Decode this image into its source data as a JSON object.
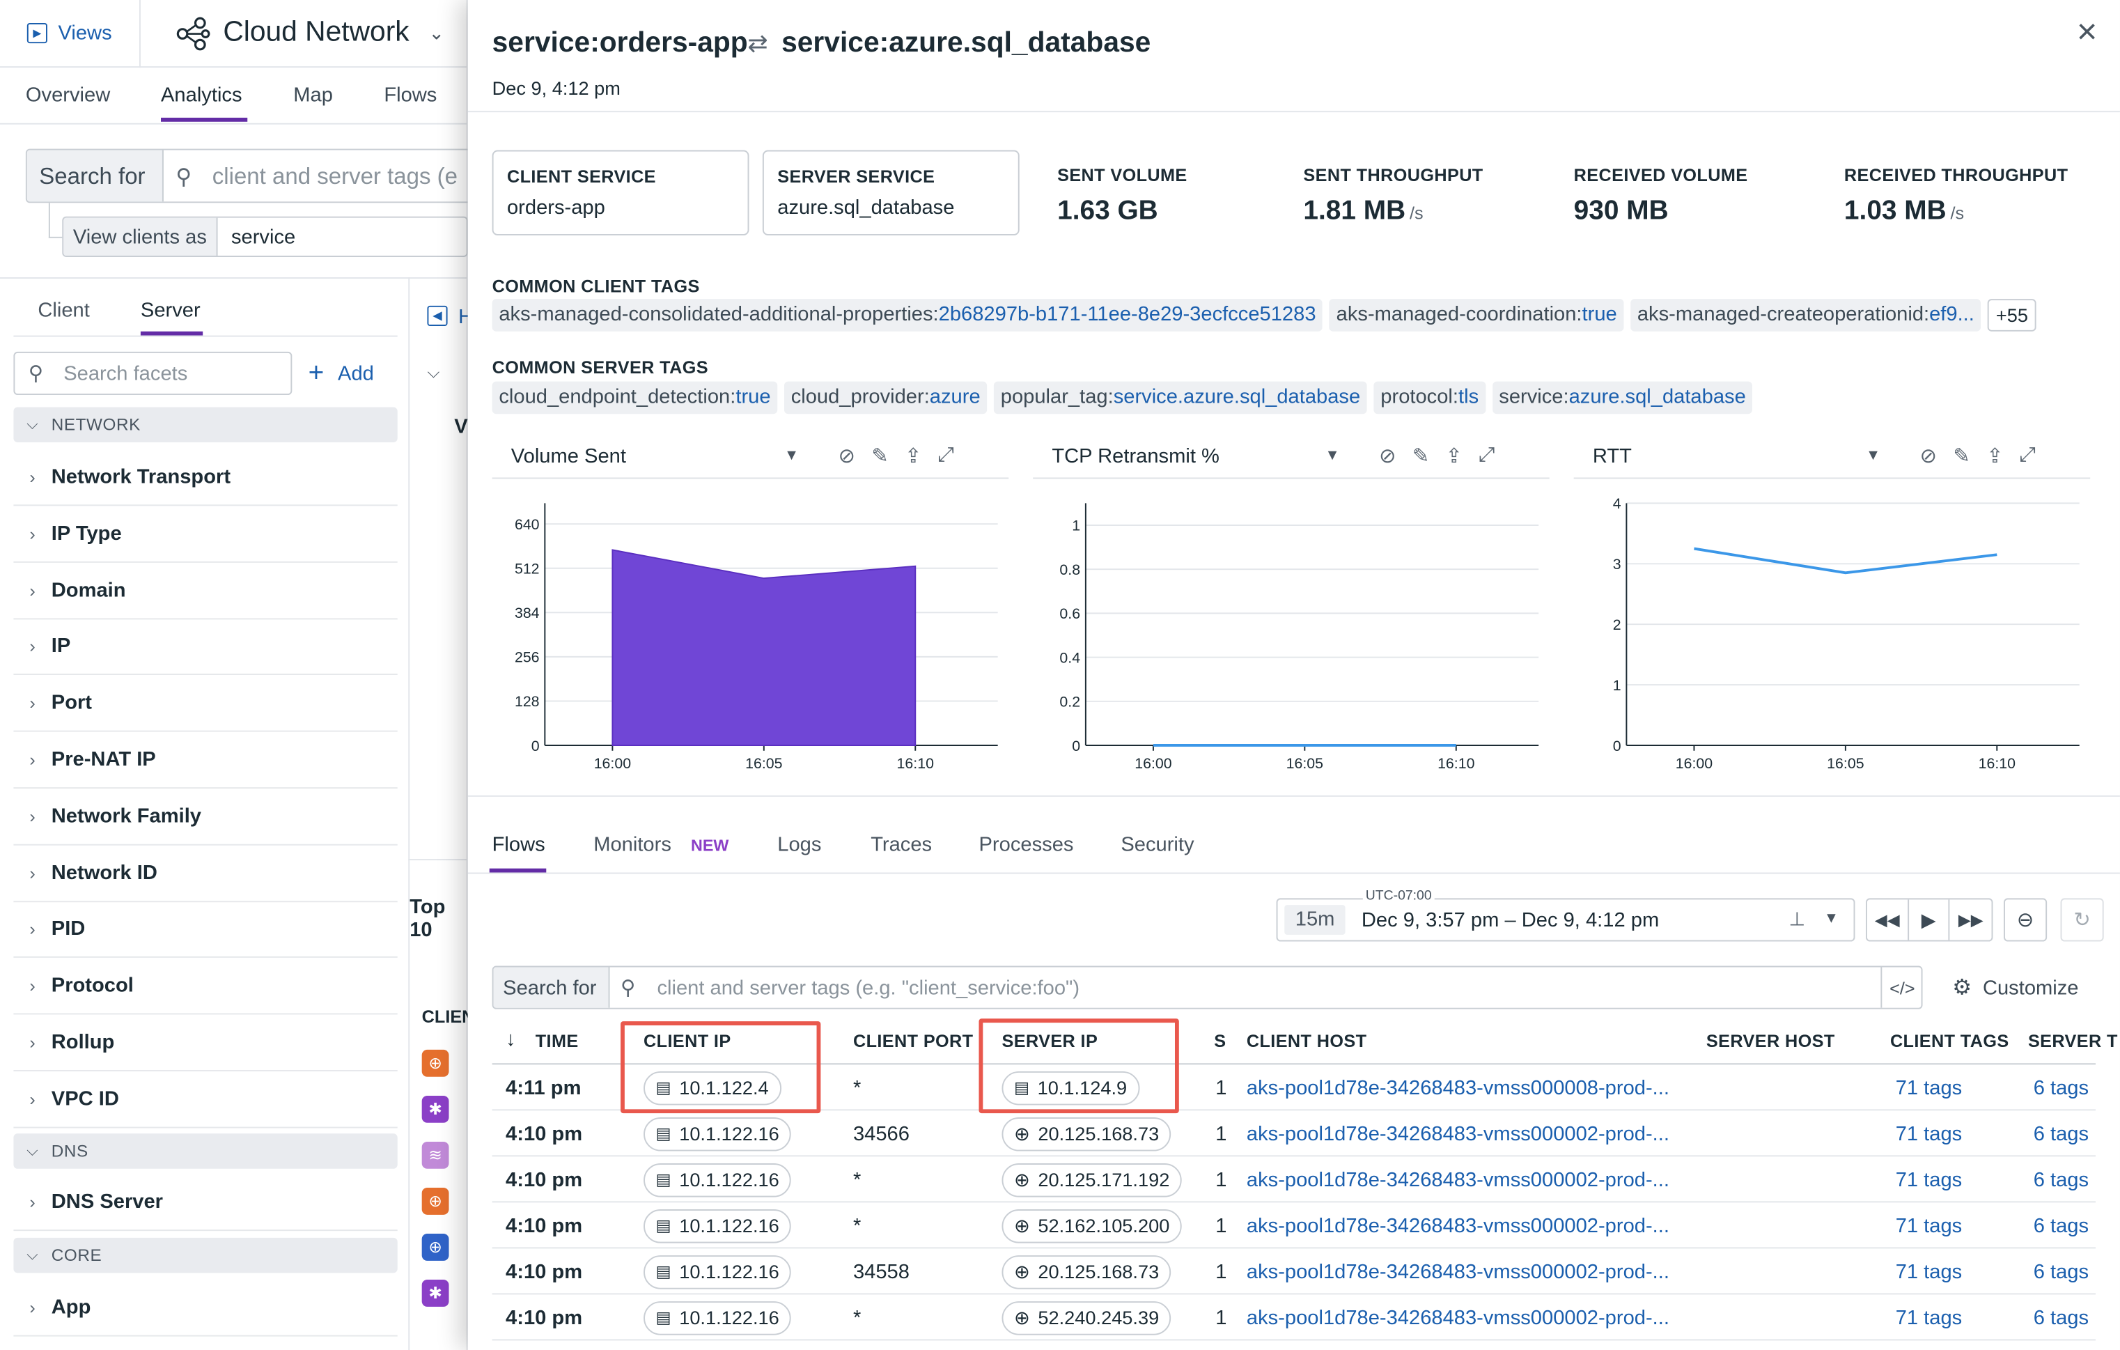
{
  "app": {
    "views_label": "Views",
    "title": "Cloud Network",
    "nav_tabs": [
      "Overview",
      "Analytics",
      "Map",
      "Flows"
    ],
    "search_for_label": "Search for",
    "search_placeholder": "client and server tags (e",
    "view_clients_as_label": "View clients as",
    "view_clients_as_value": "service",
    "facet_tabs": [
      "Client",
      "Server"
    ],
    "search_facets_placeholder": "Search facets",
    "add_label": "Add",
    "sections": {
      "network": "NETWORK",
      "dns": "DNS",
      "core": "CORE"
    },
    "network_facets": [
      "Network Transport",
      "IP Type",
      "Domain",
      "IP",
      "Port",
      "Pre-NAT IP",
      "Network Family",
      "Network ID",
      "PID",
      "Protocol",
      "Rollup",
      "VPC ID"
    ],
    "dns_facets": [
      "DNS Server"
    ],
    "core_facets": [
      "App"
    ],
    "partial_texts": {
      "top_label": "Top 10",
      "clien_label": "CLIEN",
      "v_label": "V",
      "h_label": "H"
    }
  },
  "panel": {
    "title_client": "service:orders-app",
    "title_server": "service:azure.sql_database",
    "date": "Dec 9, 4:12 pm",
    "client_service": {
      "label": "CLIENT SERVICE",
      "value": "orders-app"
    },
    "server_service": {
      "label": "SERVER SERVICE",
      "value": "azure.sql_database"
    },
    "stats": [
      {
        "label": "SENT VOLUME",
        "value": "1.63 GB",
        "unit": ""
      },
      {
        "label": "SENT THROUGHPUT",
        "value": "1.81 MB",
        "unit": "/s"
      },
      {
        "label": "RECEIVED VOLUME",
        "value": "930 MB",
        "unit": ""
      },
      {
        "label": "RECEIVED THROUGHPUT",
        "value": "1.03 MB",
        "unit": "/s"
      }
    ],
    "common_client_tags_label": "COMMON CLIENT TAGS",
    "common_client_tags": [
      {
        "k": "aks-managed-consolidated-additional-properties:",
        "v": "2b68297b-b171-11ee-8e29-3ecfcce51283"
      },
      {
        "k": "aks-managed-coordination:",
        "v": "true"
      },
      {
        "k": "aks-managed-createoperationid:",
        "v": "ef9..."
      }
    ],
    "client_tags_more": "+55",
    "common_server_tags_label": "COMMON SERVER TAGS",
    "common_server_tags": [
      {
        "k": "cloud_endpoint_detection:",
        "v": "true"
      },
      {
        "k": "cloud_provider:",
        "v": "azure"
      },
      {
        "k": "popular_tag:",
        "v": "service.azure.sql_database"
      },
      {
        "k": "protocol:",
        "v": "tls"
      },
      {
        "k": "service:",
        "v": "azure.sql_database"
      }
    ],
    "widgets": [
      "Volume Sent",
      "TCP Retransmit %",
      "RTT"
    ],
    "flow_tabs": [
      "Flows",
      "Monitors",
      "Logs",
      "Traces",
      "Processes",
      "Security"
    ],
    "new_badge": "NEW",
    "timezone": "UTC-07:00",
    "time_window": "15m",
    "time_range": "Dec 9, 3:57 pm – Dec 9, 4:12 pm",
    "flows_search_label": "Search for",
    "flows_search_placeholder": "client and server tags (e.g. \"client_service:foo\")",
    "customize_label": "Customize",
    "table_headers": [
      "TIME",
      "CLIENT IP",
      "CLIENT PORT",
      "SERVER IP",
      "S",
      "CLIENT HOST",
      "SERVER HOST",
      "CLIENT TAGS",
      "SERVER T"
    ],
    "rows": [
      {
        "time": "4:11 pm",
        "client_ip": "10.1.122.4",
        "client_port": "*",
        "server_ip": "10.1.124.9",
        "server_ip_type": "host",
        "s": "1",
        "client_host": "aks-pool1d78e-34268483-vmss000008-prod-...",
        "client_tags": "71 tags",
        "server_tags": "6 tags"
      },
      {
        "time": "4:10 pm",
        "client_ip": "10.1.122.16",
        "client_port": "34566",
        "server_ip": "20.125.168.73",
        "server_ip_type": "globe",
        "s": "1",
        "client_host": "aks-pool1d78e-34268483-vmss000002-prod-...",
        "client_tags": "71 tags",
        "server_tags": "6 tags"
      },
      {
        "time": "4:10 pm",
        "client_ip": "10.1.122.16",
        "client_port": "*",
        "server_ip": "20.125.171.192",
        "server_ip_type": "globe",
        "s": "1",
        "client_host": "aks-pool1d78e-34268483-vmss000002-prod-...",
        "client_tags": "71 tags",
        "server_tags": "6 tags"
      },
      {
        "time": "4:10 pm",
        "client_ip": "10.1.122.16",
        "client_port": "*",
        "server_ip": "52.162.105.200",
        "server_ip_type": "globe",
        "s": "1",
        "client_host": "aks-pool1d78e-34268483-vmss000002-prod-...",
        "client_tags": "71 tags",
        "server_tags": "6 tags"
      },
      {
        "time": "4:10 pm",
        "client_ip": "10.1.122.16",
        "client_port": "34558",
        "server_ip": "20.125.168.73",
        "server_ip_type": "globe",
        "s": "1",
        "client_host": "aks-pool1d78e-34268483-vmss000002-prod-...",
        "client_tags": "71 tags",
        "server_tags": "6 tags"
      },
      {
        "time": "4:10 pm",
        "client_ip": "10.1.122.16",
        "client_port": "*",
        "server_ip": "52.240.245.39",
        "server_ip_type": "globe",
        "s": "1",
        "client_host": "aks-pool1d78e-34268483-vmss000002-prod-...",
        "client_tags": "71 tags",
        "server_tags": "6 tags"
      }
    ],
    "colors": {
      "accent": "#632ca6",
      "area_fill": "#7046d6",
      "line": "#3b97e8",
      "link": "#1b5fae",
      "highlight": "#e9584d"
    }
  },
  "chart_data": [
    {
      "type": "area",
      "x": [
        "16:00",
        "16:05",
        "16:10"
      ],
      "values": [
        565,
        483,
        518
      ],
      "ylim": [
        0,
        700
      ],
      "yticks": [
        0,
        128,
        256,
        384,
        512,
        640
      ],
      "title": "Volume Sent"
    },
    {
      "type": "line",
      "x": [
        "16:00",
        "16:05",
        "16:10"
      ],
      "values": [
        0,
        0,
        0
      ],
      "ylim": [
        0,
        1.1
      ],
      "yticks": [
        0,
        0.2,
        0.4,
        0.6,
        0.8,
        1
      ],
      "title": "TCP Retransmit %"
    },
    {
      "type": "line",
      "x": [
        "16:00",
        "16:05",
        "16:10"
      ],
      "values": [
        3.25,
        2.85,
        3.15
      ],
      "ylim": [
        0,
        4
      ],
      "yticks": [
        0,
        1,
        2,
        3,
        4
      ],
      "title": "RTT"
    }
  ]
}
